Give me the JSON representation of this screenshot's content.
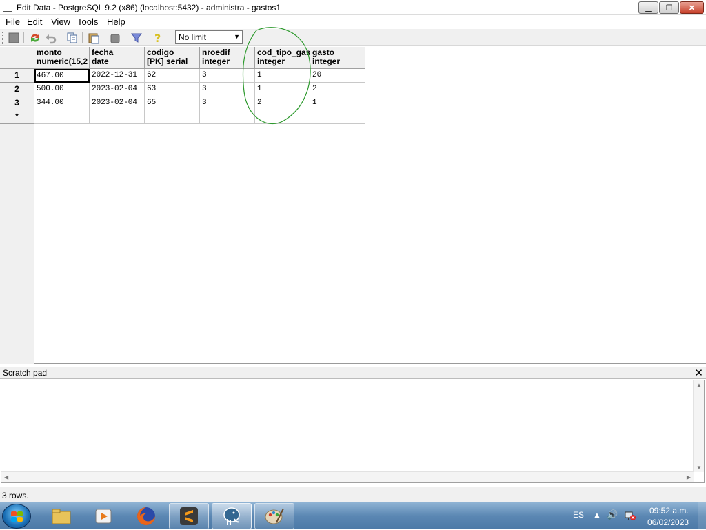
{
  "window": {
    "title": "Edit Data - PostgreSQL 9.2 (x86) (localhost:5432) - administra - gastos1",
    "minimize_icon": "minimize-icon",
    "maximize_icon": "restore-icon",
    "close_icon": "close-icon"
  },
  "menu": {
    "items": [
      "File",
      "Edit",
      "View",
      "Tools",
      "Help"
    ]
  },
  "toolbar": {
    "icons": [
      "save-icon",
      "refresh-icon",
      "undo-icon",
      "copy-icon",
      "paste-icon",
      "delete-icon",
      "filter-icon",
      "help-icon"
    ],
    "limit_value": "No limit"
  },
  "grid": {
    "columns": [
      {
        "name": "monto",
        "type": "numeric(15,2"
      },
      {
        "name": "fecha",
        "type": "date"
      },
      {
        "name": "codigo",
        "type": "[PK] serial"
      },
      {
        "name": "nroedif",
        "type": "integer"
      },
      {
        "name": "cod_tipo_gas",
        "type": "integer"
      },
      {
        "name": "gasto",
        "type": "integer"
      }
    ],
    "row_labels": [
      "1",
      "2",
      "3",
      "*"
    ],
    "rows": [
      [
        "467.00",
        "2022-12-31",
        "62",
        "3",
        "1",
        "20"
      ],
      [
        "500.00",
        "2023-02-04",
        "63",
        "3",
        "1",
        "2"
      ],
      [
        "344.00",
        "2023-02-04",
        "65",
        "3",
        "2",
        "1"
      ],
      [
        "",
        "",
        "",
        "",
        "",
        ""
      ]
    ],
    "annotation_color": "#2e9a2e"
  },
  "scratch_pad": {
    "title": "Scratch pad",
    "close_label": "✕",
    "content": ""
  },
  "status": {
    "text": "3 rows."
  },
  "taskbar": {
    "apps": [
      "windows-explorer-icon",
      "media-player-icon",
      "firefox-icon",
      "sublime-text-icon",
      "pgadmin-elephant-icon",
      "paint-icon"
    ],
    "language": "ES",
    "time": "09:52 a.m.",
    "date": "06/02/2023"
  }
}
